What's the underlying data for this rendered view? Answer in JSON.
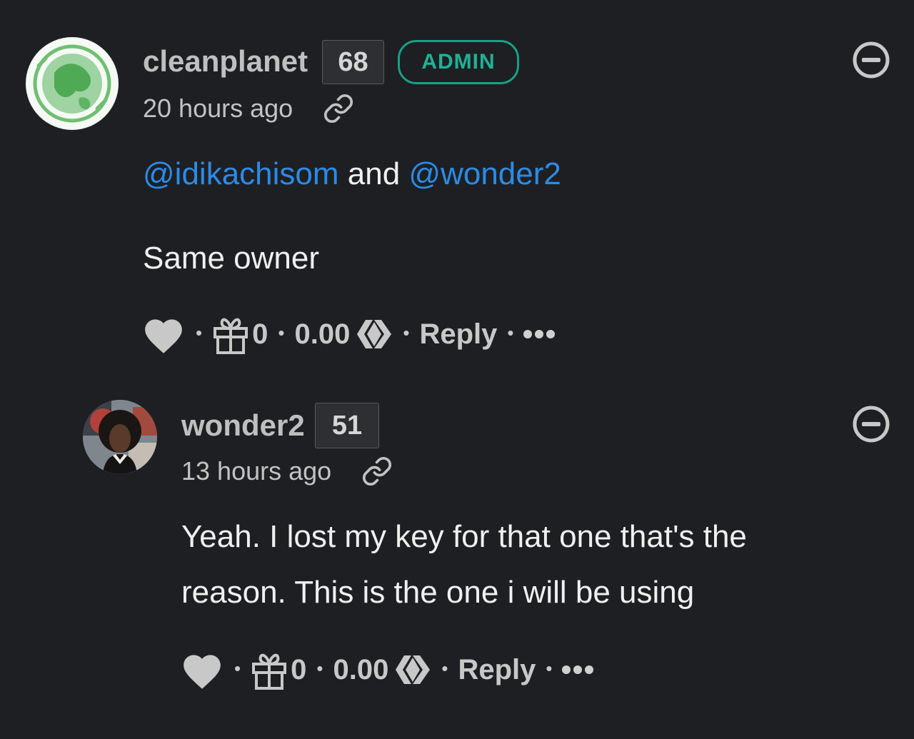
{
  "comments": [
    {
      "username": "cleanplanet",
      "reputation": "68",
      "badge": "ADMIN",
      "timestamp": "20 hours ago",
      "mentions": [
        "@idikachisom",
        "@wonder2"
      ],
      "mention_joiner": " and ",
      "body": "Same owner",
      "gift_count": "0",
      "payout": "0.00",
      "reply_label": "Reply"
    },
    {
      "username": "wonder2",
      "reputation": "51",
      "timestamp": "13 hours ago",
      "body_line1": "Yeah. I lost my key for that one that's the",
      "body_line2": "reason. This is the one i will be using",
      "gift_count": "0",
      "payout": "0.00",
      "reply_label": "Reply"
    }
  ],
  "colors": {
    "background": "#1e1f23",
    "mention": "#2b8be6",
    "admin": "#17a085"
  },
  "icons": [
    "heart-icon",
    "gift-icon",
    "hive-logo-icon",
    "link-icon",
    "collapse-icon",
    "more-icon"
  ]
}
